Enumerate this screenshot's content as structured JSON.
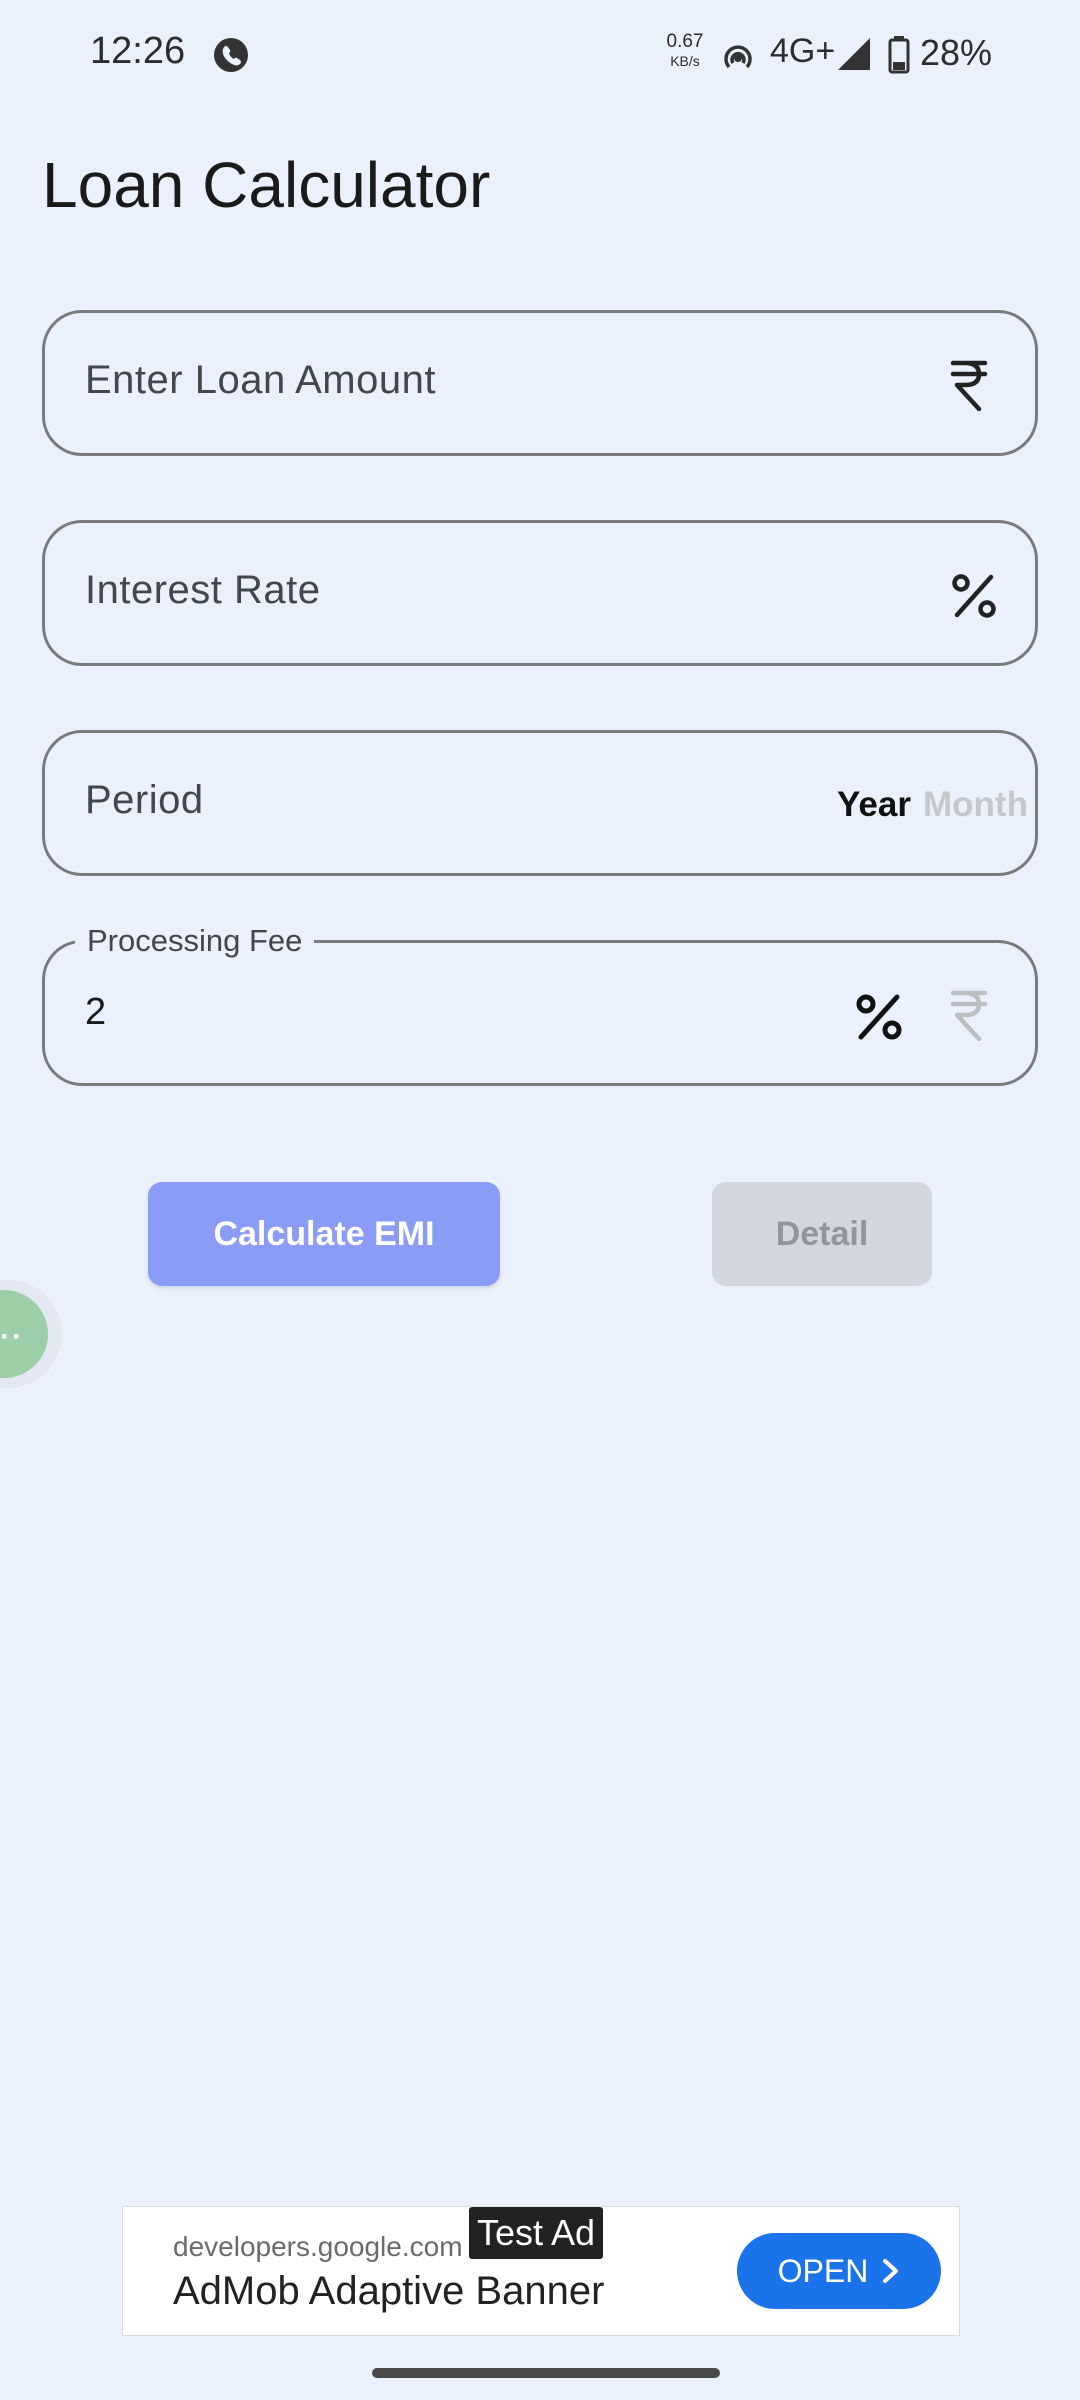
{
  "status_bar": {
    "time": "12:26",
    "speed_value": "0.67",
    "speed_unit": "KB/s",
    "network": "4G+",
    "battery": "28%"
  },
  "app": {
    "title": "Loan Calculator"
  },
  "form": {
    "loan_amount": {
      "placeholder": "Enter Loan Amount",
      "icon": "rupee-icon"
    },
    "interest_rate": {
      "placeholder": "Interest Rate",
      "icon": "percent-icon"
    },
    "period": {
      "placeholder": "Period",
      "unit_year": "Year",
      "unit_month": "Month",
      "selected_unit": "Year"
    },
    "processing_fee": {
      "label": "Processing Fee",
      "value": "2",
      "selected_unit": "percent"
    }
  },
  "buttons": {
    "calculate": "Calculate EMI",
    "detail": "Detail"
  },
  "ad": {
    "domain": "developers.google.com",
    "title": "AdMob Adaptive Banner",
    "tag": "Test Ad",
    "cta": "OPEN"
  },
  "colors": {
    "background": "#eaf0fc",
    "primary_button": "#8a9cf5",
    "disabled_button": "#d3d6df",
    "ad_cta": "#1a73e8",
    "bubble": "#9ccfa8"
  }
}
